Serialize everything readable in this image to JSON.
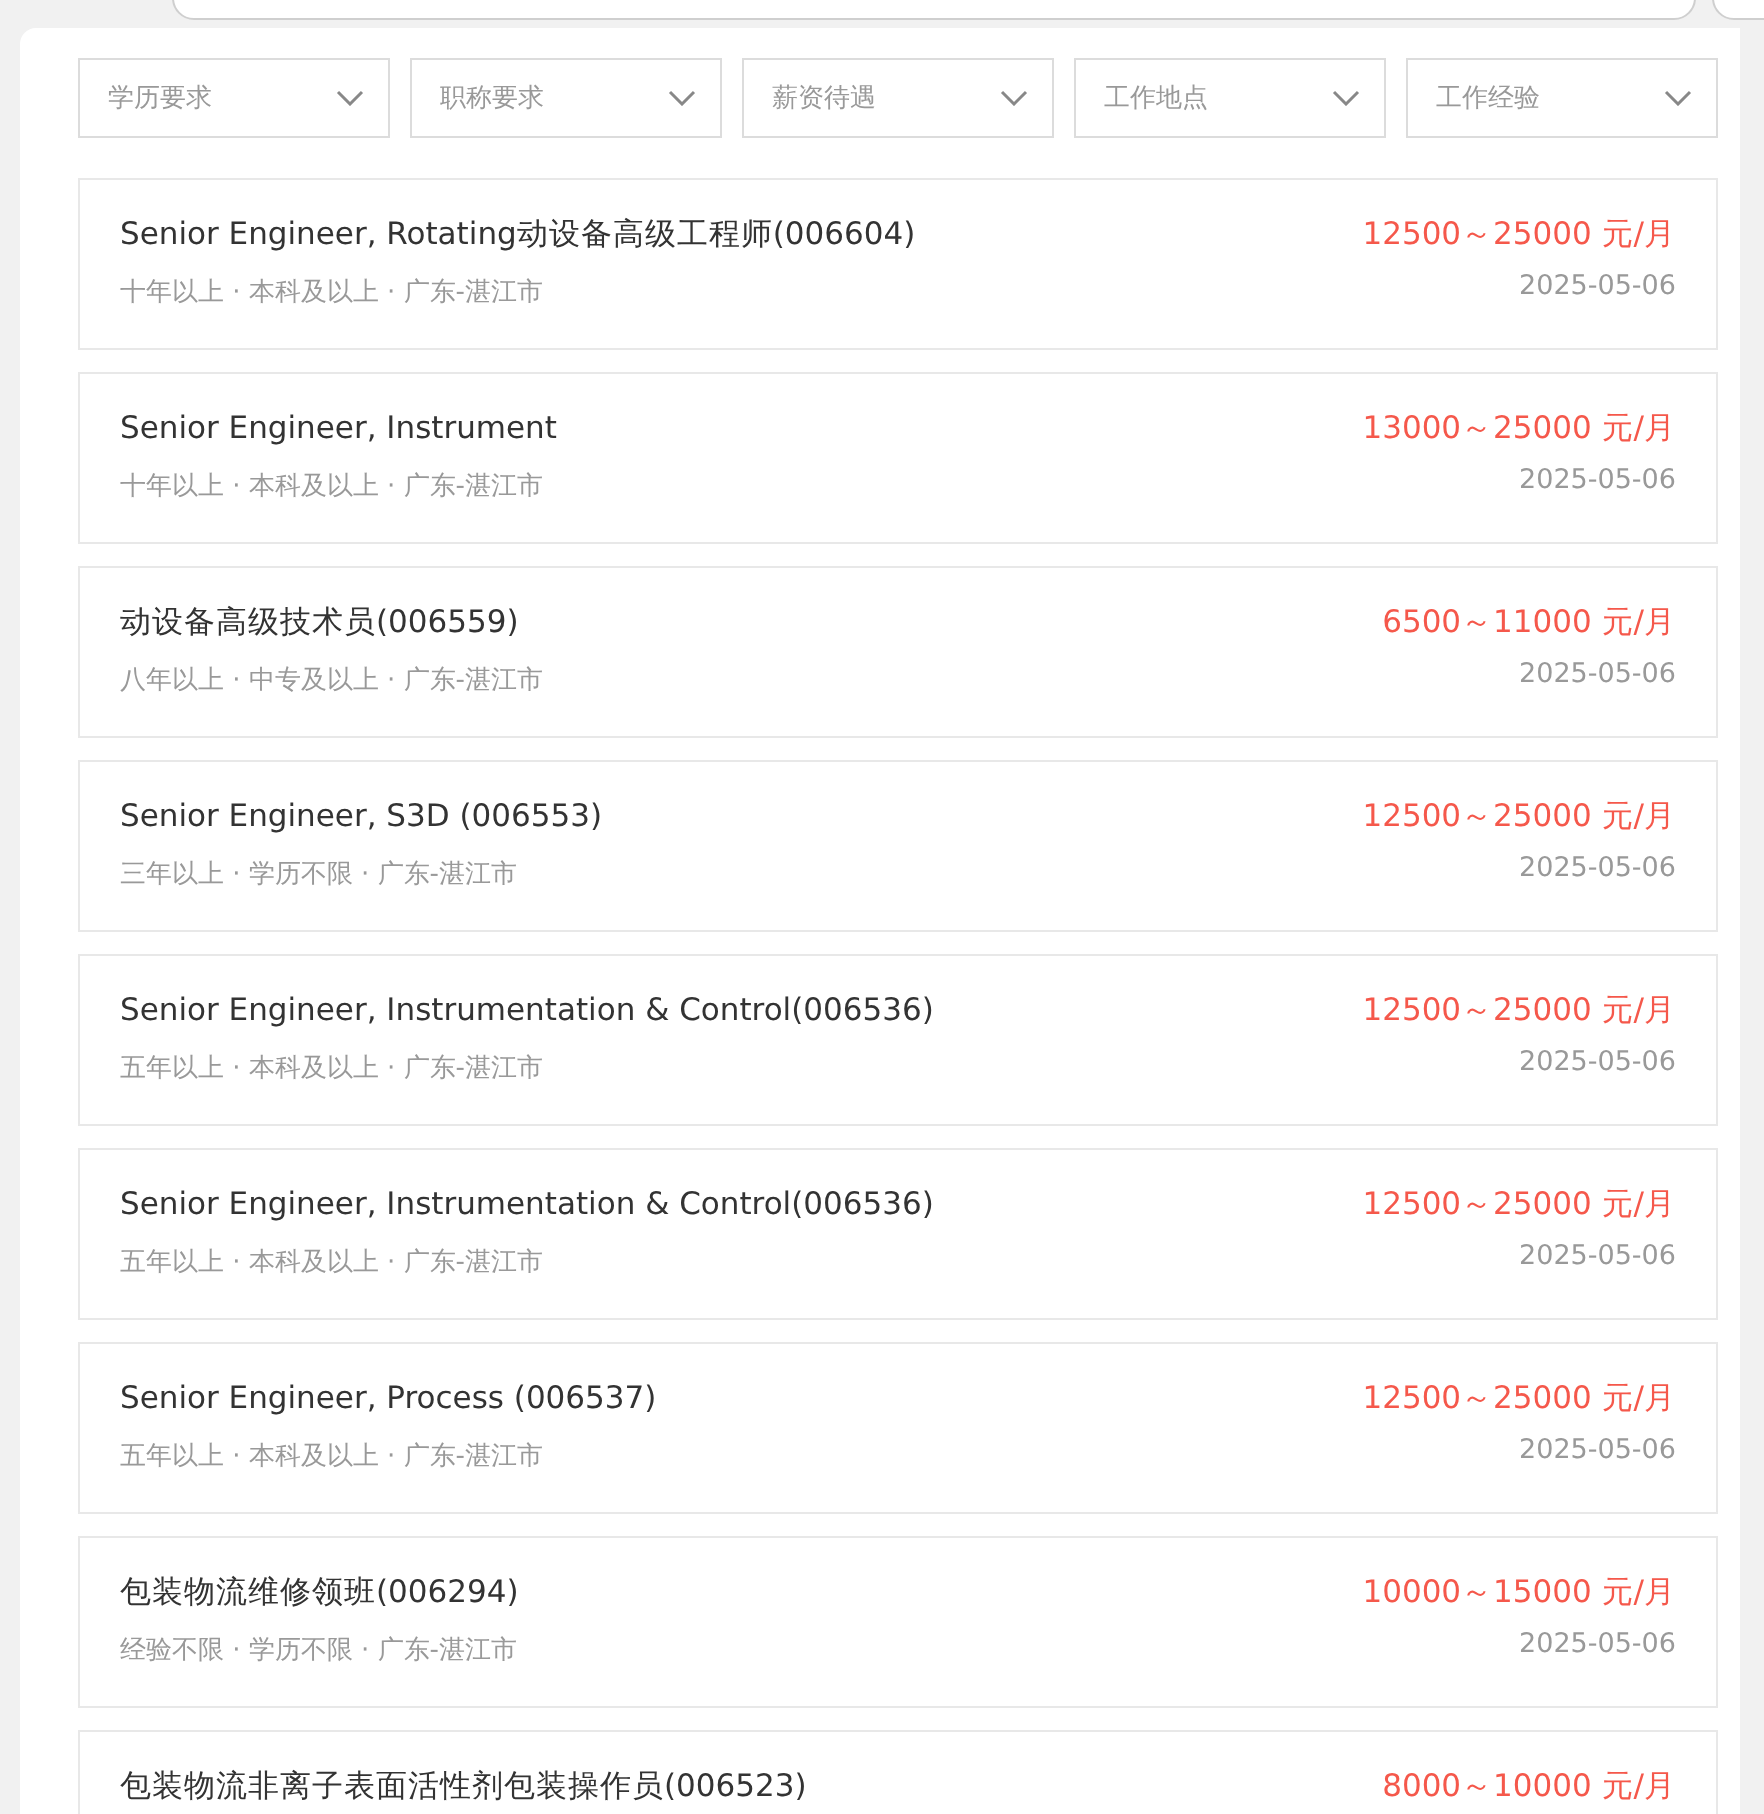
{
  "filters": [
    {
      "label": "学历要求"
    },
    {
      "label": "职称要求"
    },
    {
      "label": "薪资待遇"
    },
    {
      "label": "工作地点"
    },
    {
      "label": "工作经验"
    }
  ],
  "jobs": [
    {
      "title": "Senior Engineer, Rotating动设备高级工程师(006604)",
      "meta": "十年以上 · 本科及以上 · 广东-湛江市",
      "salary": "12500～25000 元/月",
      "date": "2025-05-06"
    },
    {
      "title": "Senior Engineer, Instrument",
      "meta": "十年以上 · 本科及以上 · 广东-湛江市",
      "salary": "13000～25000 元/月",
      "date": "2025-05-06"
    },
    {
      "title": "动设备高级技术员(006559)",
      "meta": "八年以上 · 中专及以上 · 广东-湛江市",
      "salary": "6500～11000 元/月",
      "date": "2025-05-06"
    },
    {
      "title": "Senior Engineer, S3D (006553)",
      "meta": "三年以上 · 学历不限 · 广东-湛江市",
      "salary": "12500～25000 元/月",
      "date": "2025-05-06"
    },
    {
      "title": "Senior Engineer, Instrumentation & Control(006536)",
      "meta": "五年以上 · 本科及以上 · 广东-湛江市",
      "salary": "12500～25000 元/月",
      "date": "2025-05-06"
    },
    {
      "title": "Senior Engineer, Instrumentation & Control(006536)",
      "meta": "五年以上 · 本科及以上 · 广东-湛江市",
      "salary": "12500～25000 元/月",
      "date": "2025-05-06"
    },
    {
      "title": "Senior Engineer, Process (006537)",
      "meta": "五年以上 · 本科及以上 · 广东-湛江市",
      "salary": "12500～25000 元/月",
      "date": "2025-05-06"
    },
    {
      "title": "包装物流维修领班(006294)",
      "meta": "经验不限 · 学历不限 · 广东-湛江市",
      "salary": "10000～15000 元/月",
      "date": "2025-05-06"
    },
    {
      "title": "包装物流非离子表面活性剂包装操作员(006523)",
      "salary": "8000～10000 元/月"
    }
  ]
}
